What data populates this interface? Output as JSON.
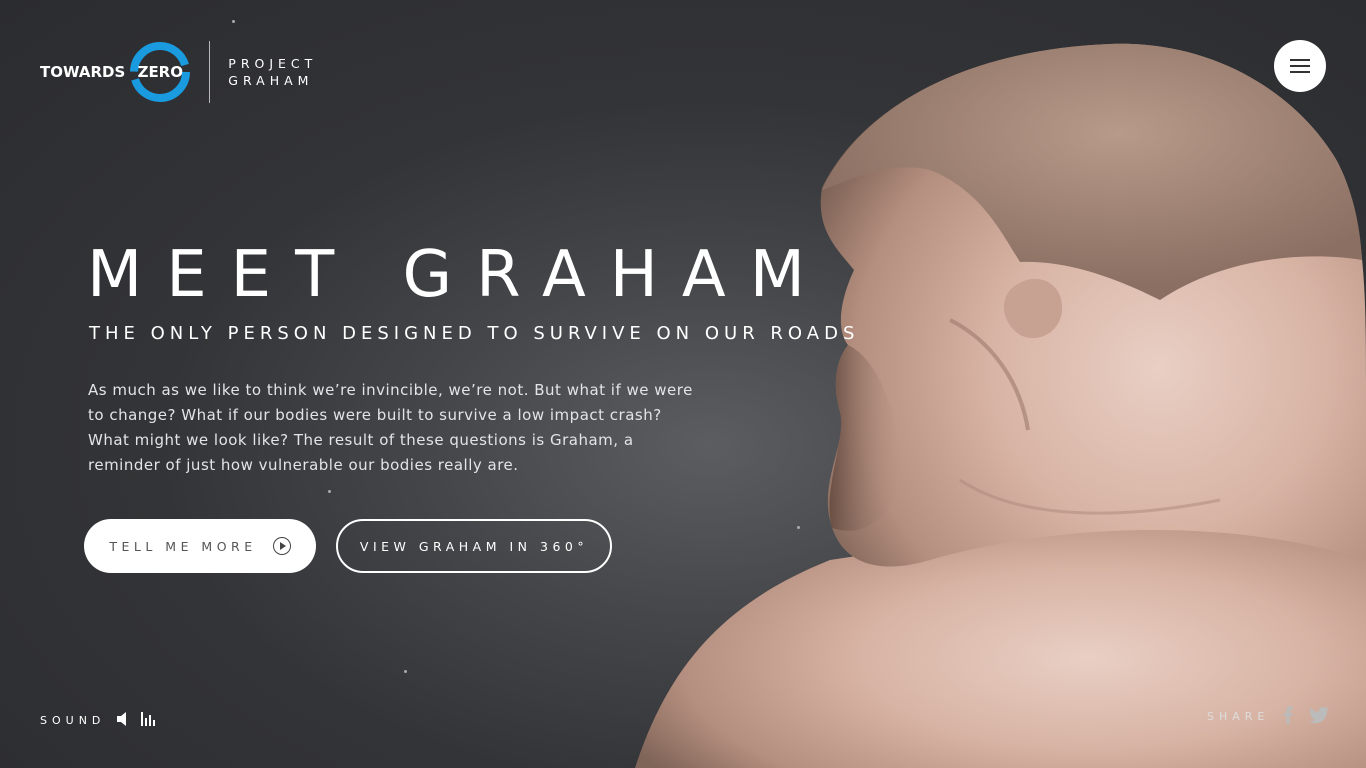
{
  "header": {
    "logo_word1": "TOWARDS",
    "logo_word2": "ZERO",
    "project_line1": "PROJECT",
    "project_line2": "GRAHAM",
    "accent_color": "#1a9be0"
  },
  "menu": {
    "icon": "hamburger-menu-icon"
  },
  "hero": {
    "title": "MEET GRAHAM",
    "subtitle": "THE ONLY PERSON DESIGNED TO SURVIVE ON OUR ROADS",
    "body": "As much as we like to think we’re invincible, we’re not. But what if we were to change? What if our bodies were built to survive a low impact crash? What might we look like? The result of these questions is Graham, a reminder of just how vulnerable our bodies really are.",
    "tell_more_label": "TELL ME MORE",
    "tell_more_icon": "play-circle-icon",
    "view_360_label": "VIEW GRAHAM IN 360°"
  },
  "footer": {
    "sound_label": "SOUND",
    "sound_icons": [
      "speaker-icon",
      "equalizer-bars-icon"
    ],
    "share_label": "SHARE",
    "share_icons": [
      "facebook-icon",
      "twitter-icon"
    ]
  },
  "colors": {
    "background": "#333437",
    "button_white": "#ffffff"
  }
}
